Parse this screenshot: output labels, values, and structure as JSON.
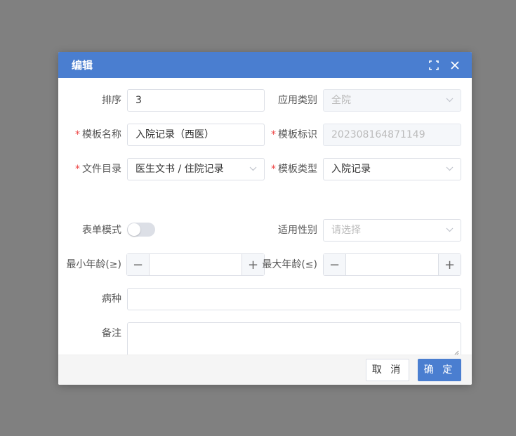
{
  "dialog": {
    "title": "编辑",
    "header_color": "#4a7ed0",
    "icons": [
      "fullscreen-icon",
      "close-icon"
    ]
  },
  "form": {
    "sort": {
      "label": "排序",
      "value": "3"
    },
    "app_category": {
      "label": "应用类别",
      "value": "全院"
    },
    "template_name": {
      "label": "模板名称",
      "required": true,
      "value": "入院记录（西医）"
    },
    "template_id": {
      "label": "模板标识",
      "required": true,
      "value": "202308164871149"
    },
    "file_dir": {
      "label": "文件目录",
      "required": true,
      "value": "医生文书 / 住院记录"
    },
    "template_type": {
      "label": "模板类型",
      "required": true,
      "value": "入院记录"
    },
    "form_mode": {
      "label": "表单模式",
      "value": false
    },
    "gender": {
      "label": "适用性别",
      "placeholder": "请选择"
    },
    "min_age": {
      "label": "最小年龄(≥)",
      "value": ""
    },
    "max_age": {
      "label": "最大年龄(≤)",
      "value": ""
    },
    "disease": {
      "label": "病种",
      "value": ""
    },
    "remark": {
      "label": "备注",
      "value": ""
    }
  },
  "footer": {
    "cancel_label": "取 消",
    "ok_label": "确 定"
  },
  "req_mark": "*"
}
